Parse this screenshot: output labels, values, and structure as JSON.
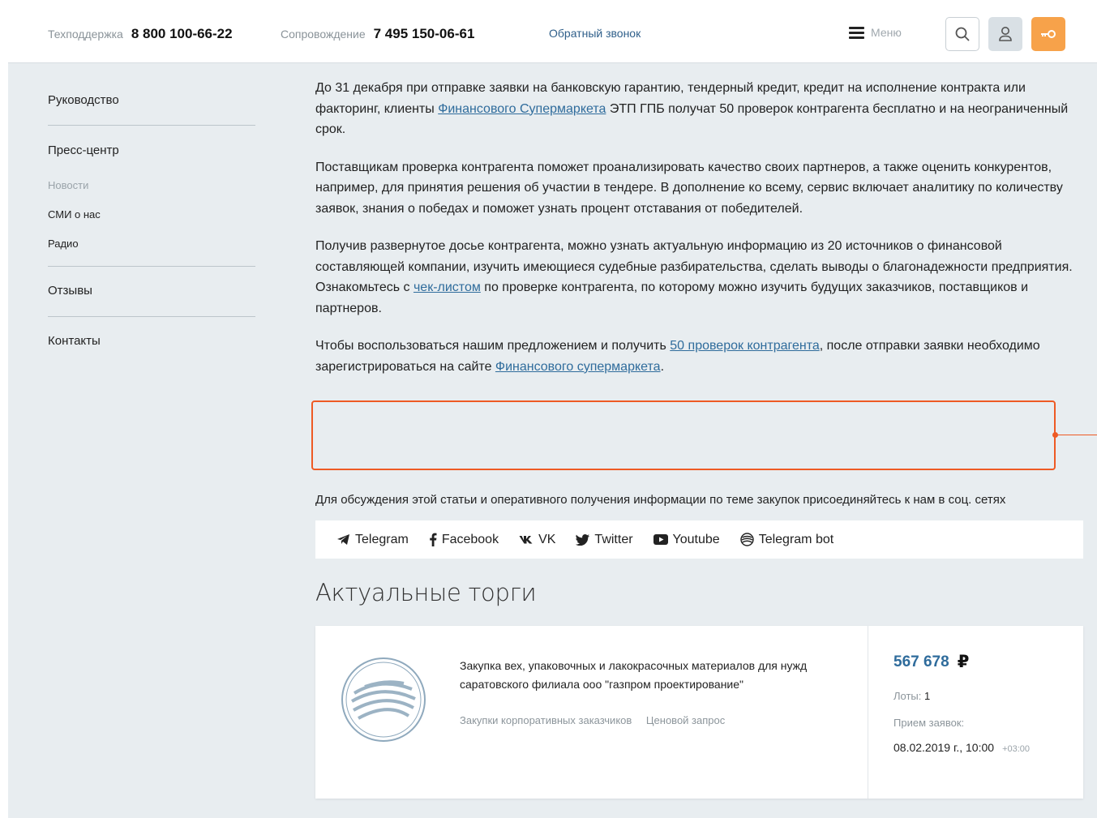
{
  "header": {
    "support_label": "Техподдержка",
    "support_phone": "8 800 100-66-22",
    "accomp_label": "Сопровождение",
    "accomp_phone": "7 495 150-06-61",
    "callback": "Обратный звонок",
    "menu": "Меню",
    "icons": [
      "search-icon",
      "user-icon",
      "key-icon"
    ],
    "accent_color": "#f7a24a"
  },
  "sidebar": {
    "items": [
      "Руководство",
      "Пресс-центр",
      "Отзывы",
      "Контакты"
    ],
    "subitems": [
      "Новости",
      "СМИ о нас",
      "Радио"
    ]
  },
  "article": {
    "p1_a": "До 31 декабря при отправке заявки на банковскую гарантию, тендерный кредит, кредит на исполнение контракта или факторинг, клиенты ",
    "p1_link": "Финансового Супермаркета",
    "p1_b": " ЭТП ГПБ получат 50 проверок контрагента бесплатно и на неограниченный срок.",
    "p2": "Поставщикам проверка контрагента поможет проанализировать качество своих партнеров, а также оценить конкурентов, например, для принятия решения об участии в тендере. В дополнение ко всему, сервис включает аналитику по количеству заявок, знания о победах и поможет узнать процент отставания от победителей.",
    "p3_a": "Получив развернутое досье контрагента, можно узнать актуальную информацию из 20 источников о финансовой составляющей компании, изучить имеющиеся судебные разбирательства, сделать выводы о благонадежности предприятия. Ознакомьтесь с ",
    "p3_link": "чек-листом",
    "p3_b": " по проверке контрагента, по которому можно изучить будущих заказчиков, поставщиков и партнеров.",
    "p4_a": "Чтобы воспользоваться нашим предложением и получить ",
    "p4_link1": "50 проверок контрагента",
    "p4_b": ", после отправки заявки необходимо зарегистрироваться на сайте ",
    "p4_link2": "Финансового супермаркета",
    "p4_c": "."
  },
  "social": {
    "note": "Для обсуждения этой статьи и оперативного получения информации по теме закупок присоединяйтесь к нам в соц. сетях",
    "links": [
      {
        "label": "Telegram",
        "icon": "telegram-icon"
      },
      {
        "label": "Facebook",
        "icon": "facebook-icon"
      },
      {
        "label": "VK",
        "icon": "vk-icon"
      },
      {
        "label": "Twitter",
        "icon": "twitter-icon"
      },
      {
        "label": "Youtube",
        "icon": "youtube-icon"
      },
      {
        "label": "Telegram bot",
        "icon": "telegram-bot-icon"
      }
    ]
  },
  "tenders": {
    "title": "Актуальные торги",
    "card": {
      "logo": "gazprombank-logo",
      "name": "Закупка вех, упаковочных и лакокрасочных материалов для нужд саратовского филиала ооо \"газпром проектирование\"",
      "tags": [
        "Закупки корпоративных заказчиков",
        "Ценовой запрос"
      ],
      "price": "567 678",
      "currency": "₽",
      "lots_label": "Лоты:",
      "lots_value": "1",
      "receipt_label": "Прием заявок:",
      "receipt_date": "08.02.2019 г., 10:00",
      "receipt_tz": "+03:00"
    }
  }
}
